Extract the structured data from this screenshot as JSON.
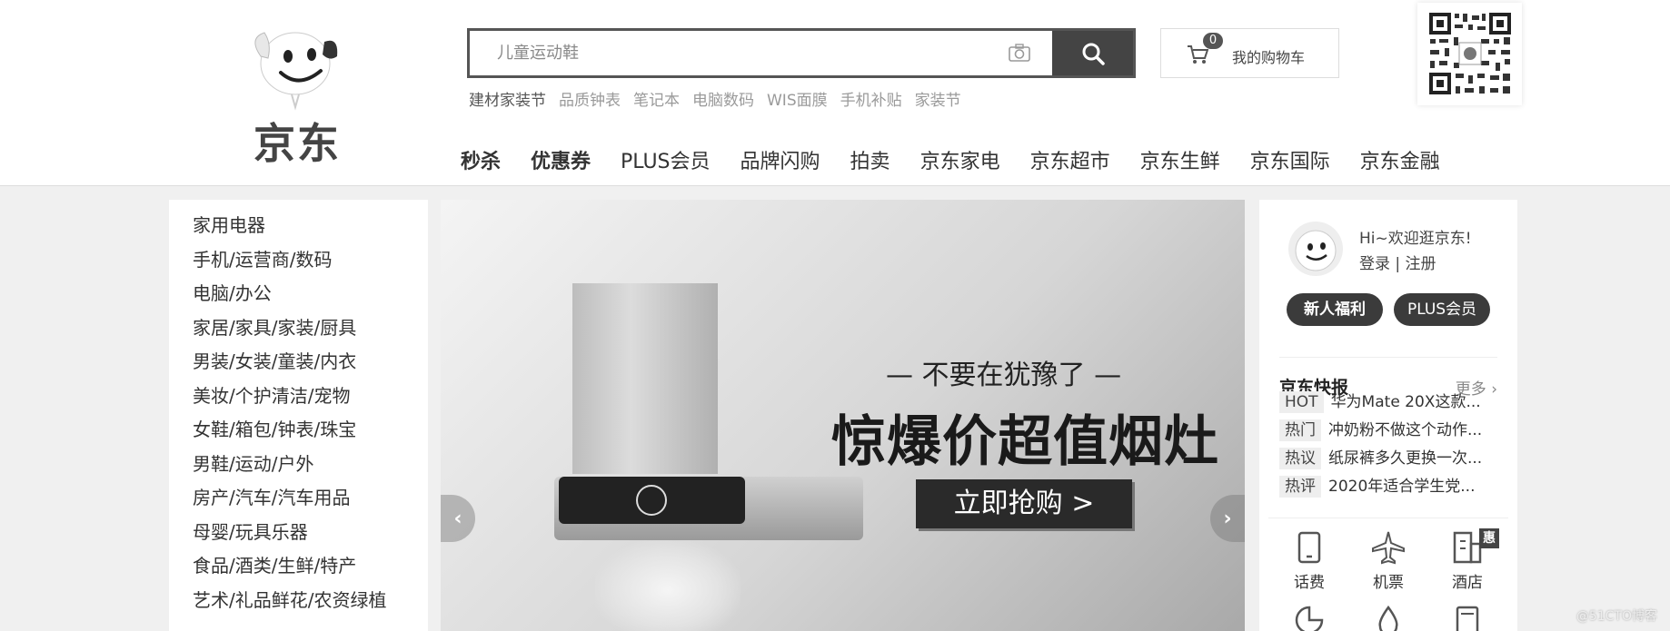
{
  "logo": {
    "text": "京东"
  },
  "search": {
    "placeholder": "儿童运动鞋"
  },
  "hotwords": [
    "建材家装节",
    "品质钟表",
    "笔记本",
    "电脑数码",
    "WIS面膜",
    "手机补贴",
    "家装节"
  ],
  "cart": {
    "count": "0",
    "label": "我的购物车"
  },
  "nav": [
    {
      "label": "秒杀"
    },
    {
      "label": "优惠券"
    },
    {
      "label": "PLUS会员"
    },
    {
      "label": "品牌闪购"
    },
    {
      "label": "拍卖"
    },
    {
      "label": "京东家电"
    },
    {
      "label": "京东超市"
    },
    {
      "label": "京东生鲜"
    },
    {
      "label": "京东国际"
    },
    {
      "label": "京东金融"
    }
  ],
  "categories": [
    "家用电器",
    "手机/运营商/数码",
    "电脑/办公",
    "家居/家具/家装/厨具",
    "男装/女装/童装/内衣",
    "美妆/个护清洁/宠物",
    "女鞋/箱包/钟表/珠宝",
    "男鞋/运动/户外",
    "房产/汽车/汽车用品",
    "母婴/玩具乐器",
    "食品/酒类/生鲜/特产",
    "艺术/礼品鲜花/农资绿植"
  ],
  "banner": {
    "subtitle": "— 不要在犹豫了 —",
    "title": "惊爆价超值烟灶",
    "cta": "立即抢购 >"
  },
  "user": {
    "welcome": "Hi~欢迎逛京东!",
    "login": "登录",
    "separator": " | ",
    "register": "注册",
    "pill_new": "新人福利",
    "pill_plus": "PLUS会员"
  },
  "news": {
    "title": "京东快报",
    "more": "更多 ›",
    "items": [
      {
        "tag": "HOT",
        "text": "华为Mate 20X这款..."
      },
      {
        "tag": "热门",
        "text": "冲奶粉不做这个动作..."
      },
      {
        "tag": "热议",
        "text": "纸尿裤多久更换一次..."
      },
      {
        "tag": "热评",
        "text": "2020年适合学生党..."
      }
    ]
  },
  "services": [
    {
      "label": "话费",
      "icon": "phone-icon"
    },
    {
      "label": "机票",
      "icon": "airplane-icon"
    },
    {
      "label": "酒店",
      "icon": "hotel-icon"
    }
  ],
  "hui_badge": "惠",
  "watermark": "@51CTO博客"
}
